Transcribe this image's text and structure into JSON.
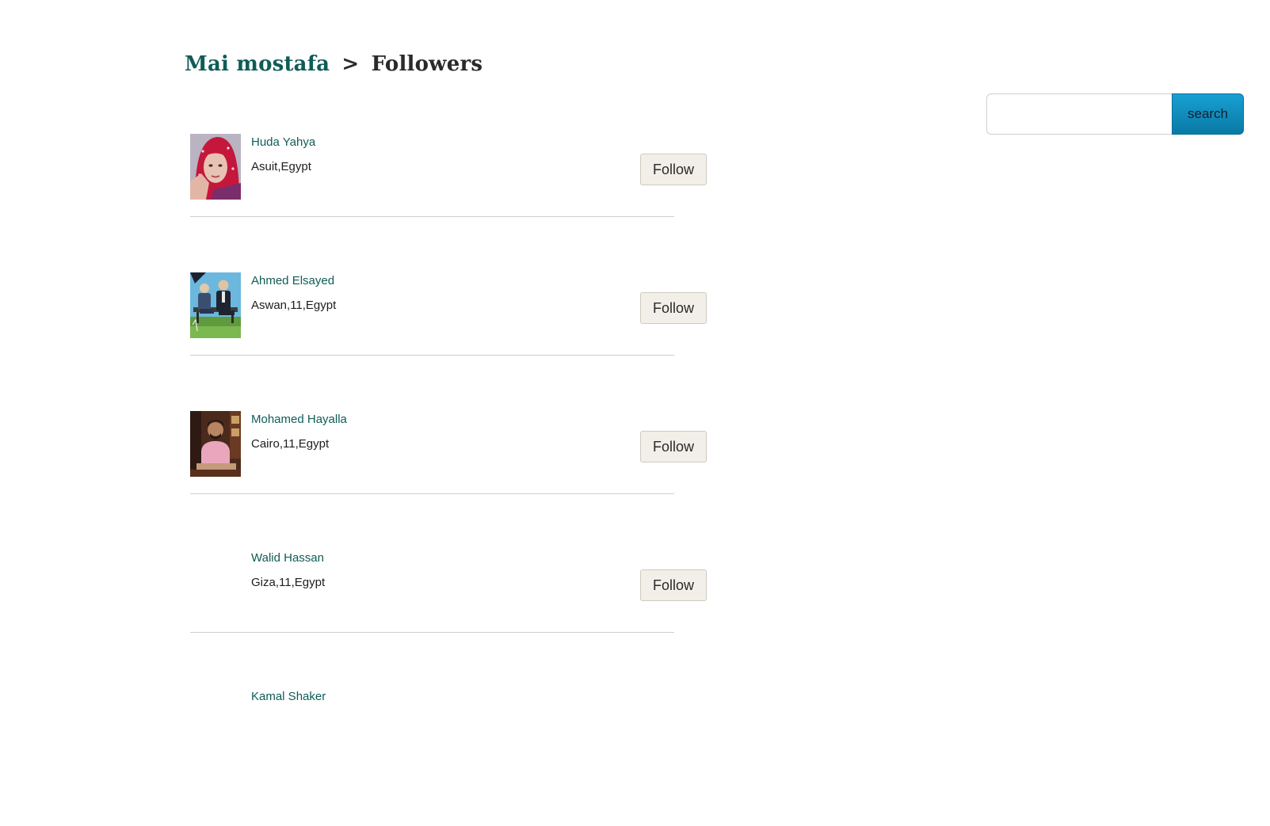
{
  "breadcrumb": {
    "profile_name": "Mai mostafa",
    "separator": ">",
    "current": "Followers"
  },
  "search": {
    "placeholder": "",
    "value": "",
    "button_label": "search"
  },
  "followers": [
    {
      "name": "Huda Yahya",
      "location": "Asuit,Egypt",
      "follow_label": "Follow",
      "avatar": "woman-in-red-hijab"
    },
    {
      "name": "Ahmed Elsayed",
      "location": "Aswan,11,Egypt",
      "follow_label": "Follow",
      "avatar": "men-on-bench-cartoon"
    },
    {
      "name": "Mohamed Hayalla",
      "location": "Cairo,11,Egypt",
      "follow_label": "Follow",
      "avatar": "man-in-pink-shirt"
    },
    {
      "name": "Walid Hassan",
      "location": "Giza,11,Egypt",
      "follow_label": "Follow",
      "avatar": ""
    },
    {
      "name": "Kamal Shaker",
      "location": "",
      "follow_label": "",
      "avatar": ""
    }
  ],
  "colors": {
    "link": "#0f5c57",
    "search_button": "#0a79a6",
    "follow_button_bg": "#f2efe9",
    "divider": "#cfcfcf"
  }
}
